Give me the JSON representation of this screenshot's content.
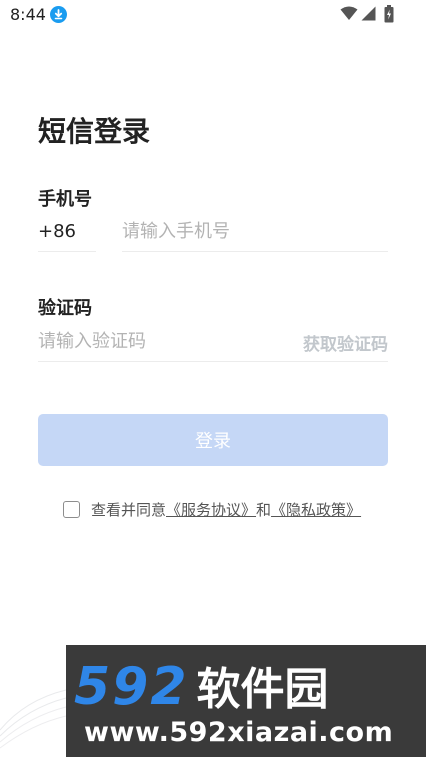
{
  "status_bar": {
    "time": "8:44",
    "icons": [
      "download-icon",
      "wifi-icon",
      "signal-icon",
      "battery-icon"
    ]
  },
  "page": {
    "title": "短信登录"
  },
  "phone": {
    "label": "手机号",
    "country_code": "+86",
    "placeholder": "请输入手机号",
    "value": ""
  },
  "code": {
    "label": "验证码",
    "placeholder": "请输入验证码",
    "value": "",
    "get_code_label": "获取验证码"
  },
  "login": {
    "button_label": "登录"
  },
  "agreement": {
    "checked": false,
    "prefix": "查看并同意",
    "service_link": "《服务协议》",
    "and": "和",
    "privacy_link": "《隐私政策》"
  },
  "watermark": {
    "logo_number": "592",
    "logo_text": "软件园",
    "url": "www.592xiazai.com"
  },
  "colors": {
    "accent": "#1a9cf0",
    "login_button_disabled": "#c5d7f6",
    "get_code_disabled": "#c2c7cc",
    "watermark_bg": "#3a3a3a",
    "watermark_number": "#2f86e8"
  }
}
